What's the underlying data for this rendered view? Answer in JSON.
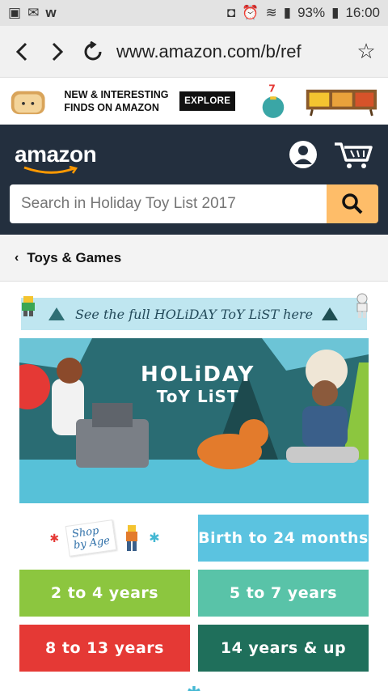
{
  "status": {
    "battery": "93%",
    "time": "16:00"
  },
  "browser": {
    "url": "www.amazon.com/b/ref"
  },
  "promo": {
    "line1": "NEW & INTERESTING",
    "line2": "FINDS ON AMAZON",
    "cta": "EXPLORE"
  },
  "header": {
    "logo": "amazon",
    "search_placeholder": "Search in Holiday Toy List 2017"
  },
  "breadcrumb": {
    "label": "Toys & Games"
  },
  "banner": {
    "text": "See the full HOLiDAY ToY LiST here"
  },
  "hero": {
    "title_line1": "HOLiDAY",
    "title_line2": "ToY LiST"
  },
  "age_tiles": {
    "shop_line1": "Shop",
    "shop_line2": "by Age",
    "birth": "Birth to 24 months",
    "t2_4": "2 to 4 years",
    "t5_7": "5 to 7 years",
    "t8_13": "8 to 13 years",
    "t14": "14 years & up"
  },
  "colors": {
    "amazon_dark": "#232f3e",
    "search_button": "#febd69",
    "tile_blue": "#5bc3e0",
    "tile_lime": "#8cc63f",
    "tile_teal": "#59c3a8",
    "tile_red": "#e53935",
    "tile_green": "#1f6f5b"
  }
}
